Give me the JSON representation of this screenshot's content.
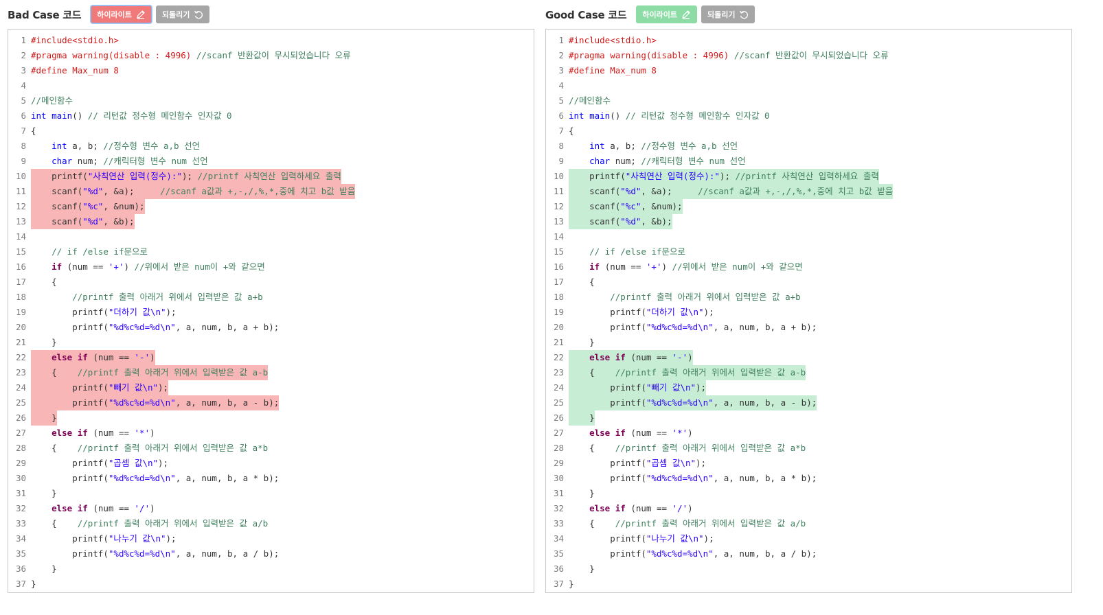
{
  "left_panel": {
    "title": "Bad Case 코드",
    "highlight_label": "하이라이트",
    "revert_label": "되돌리기",
    "highlighted_lines": [
      10,
      11,
      12,
      13,
      22,
      23,
      24,
      25,
      26
    ]
  },
  "right_panel": {
    "title": "Good Case 코드",
    "highlight_label": "하이라이트",
    "revert_label": "되돌리기",
    "highlighted_lines": [
      10,
      11,
      12,
      13,
      22,
      23,
      24,
      25,
      26
    ]
  },
  "colors": {
    "bad_highlight": "#f9b6b6",
    "good_highlight": "#c7eed4",
    "bad_button": "#f07a7a",
    "good_button": "#8ddca6",
    "revert_button": "#a6a6a6"
  },
  "icons": {
    "highlight": "pencil-icon",
    "revert": "undo-icon"
  },
  "code_lines": [
    [
      [
        "prep",
        "#include<stdio.h>"
      ]
    ],
    [
      [
        "prep",
        "#pragma warning(disable : 4996) "
      ],
      [
        "cmt",
        "//scanf 반환값이 무시되었습니다 오류"
      ]
    ],
    [
      [
        "prep",
        "#define Max_num 8"
      ]
    ],
    [],
    [
      [
        "cmt",
        "//메인함수"
      ]
    ],
    [
      [
        "kw",
        "int"
      ],
      [
        "plain",
        " "
      ],
      [
        "kw",
        "main"
      ],
      [
        "plain",
        "() "
      ],
      [
        "cmt",
        "// 리턴값 정수형 메인함수 인자값 0"
      ]
    ],
    [
      [
        "plain",
        "{"
      ]
    ],
    [
      [
        "plain",
        "    "
      ],
      [
        "kw",
        "int"
      ],
      [
        "plain",
        " a, b; "
      ],
      [
        "cmt",
        "//정수형 변수 a,b 선언"
      ]
    ],
    [
      [
        "plain",
        "    "
      ],
      [
        "kw",
        "char"
      ],
      [
        "plain",
        " num; "
      ],
      [
        "cmt",
        "//캐릭터형 변수 num 선언"
      ]
    ],
    [
      [
        "plain",
        "    printf("
      ],
      [
        "str",
        "\"사칙연산 입력(정수):\""
      ],
      [
        "plain",
        "); "
      ],
      [
        "cmt",
        "//printf 사칙연산 입력하세요 출력"
      ]
    ],
    [
      [
        "plain",
        "    scanf("
      ],
      [
        "str",
        "\"%d\""
      ],
      [
        "plain",
        ", &a);     "
      ],
      [
        "cmt",
        "//scanf a값과 +,-,/,%,*,중에 치고 b값 받음"
      ]
    ],
    [
      [
        "plain",
        "    scanf("
      ],
      [
        "str",
        "\"%c\""
      ],
      [
        "plain",
        ", &num);"
      ]
    ],
    [
      [
        "plain",
        "    scanf("
      ],
      [
        "str",
        "\"%d\""
      ],
      [
        "plain",
        ", &b);"
      ]
    ],
    [],
    [
      [
        "plain",
        "    "
      ],
      [
        "cmt",
        "// if /else if문으로"
      ]
    ],
    [
      [
        "plain",
        "    "
      ],
      [
        "kwb",
        "if"
      ],
      [
        "plain",
        " (num == "
      ],
      [
        "str",
        "'+'"
      ],
      [
        "plain",
        ") "
      ],
      [
        "cmt",
        "//위에서 받은 num이 +와 같으면"
      ]
    ],
    [
      [
        "plain",
        "    {"
      ]
    ],
    [
      [
        "plain",
        "        "
      ],
      [
        "cmt",
        "//printf 출력 아래거 위에서 입력받은 값 a+b"
      ]
    ],
    [
      [
        "plain",
        "        printf("
      ],
      [
        "str",
        "\"더하기 값\\n\""
      ],
      [
        "plain",
        ");"
      ]
    ],
    [
      [
        "plain",
        "        printf("
      ],
      [
        "str",
        "\"%d%c%d=%d\\n\""
      ],
      [
        "plain",
        ", a, num, b, a + b);"
      ]
    ],
    [
      [
        "plain",
        "    }"
      ]
    ],
    [
      [
        "plain",
        "    "
      ],
      [
        "kwb",
        "else if"
      ],
      [
        "plain",
        " (num == "
      ],
      [
        "str",
        "'-'"
      ],
      [
        "plain",
        ")"
      ]
    ],
    [
      [
        "plain",
        "    {    "
      ],
      [
        "cmt",
        "//printf 출력 아래거 위에서 입력받은 값 a-b"
      ]
    ],
    [
      [
        "plain",
        "        printf("
      ],
      [
        "str",
        "\"빼기 값\\n\""
      ],
      [
        "plain",
        ");"
      ]
    ],
    [
      [
        "plain",
        "        printf("
      ],
      [
        "str",
        "\"%d%c%d=%d\\n\""
      ],
      [
        "plain",
        ", a, num, b, a - b);"
      ]
    ],
    [
      [
        "plain",
        "    }"
      ]
    ],
    [
      [
        "plain",
        "    "
      ],
      [
        "kwb",
        "else if"
      ],
      [
        "plain",
        " (num == "
      ],
      [
        "str",
        "'*'"
      ],
      [
        "plain",
        ")"
      ]
    ],
    [
      [
        "plain",
        "    {    "
      ],
      [
        "cmt",
        "//printf 출력 아래거 위에서 입력받은 값 a*b"
      ]
    ],
    [
      [
        "plain",
        "        printf("
      ],
      [
        "str",
        "\"곱셈 값\\n\""
      ],
      [
        "plain",
        ");"
      ]
    ],
    [
      [
        "plain",
        "        printf("
      ],
      [
        "str",
        "\"%d%c%d=%d\\n\""
      ],
      [
        "plain",
        ", a, num, b, a * b);"
      ]
    ],
    [
      [
        "plain",
        "    }"
      ]
    ],
    [
      [
        "plain",
        "    "
      ],
      [
        "kwb",
        "else if"
      ],
      [
        "plain",
        " (num == "
      ],
      [
        "str",
        "'/'"
      ],
      [
        "plain",
        ")"
      ]
    ],
    [
      [
        "plain",
        "    {    "
      ],
      [
        "cmt",
        "//printf 출력 아래거 위에서 입력받은 값 a/b"
      ]
    ],
    [
      [
        "plain",
        "        printf("
      ],
      [
        "str",
        "\"나누기 값\\n\""
      ],
      [
        "plain",
        ");"
      ]
    ],
    [
      [
        "plain",
        "        printf("
      ],
      [
        "str",
        "\"%d%c%d=%d\\n\""
      ],
      [
        "plain",
        ", a, num, b, a / b);"
      ]
    ],
    [
      [
        "plain",
        "    }"
      ]
    ],
    [
      [
        "plain",
        "}"
      ]
    ]
  ]
}
